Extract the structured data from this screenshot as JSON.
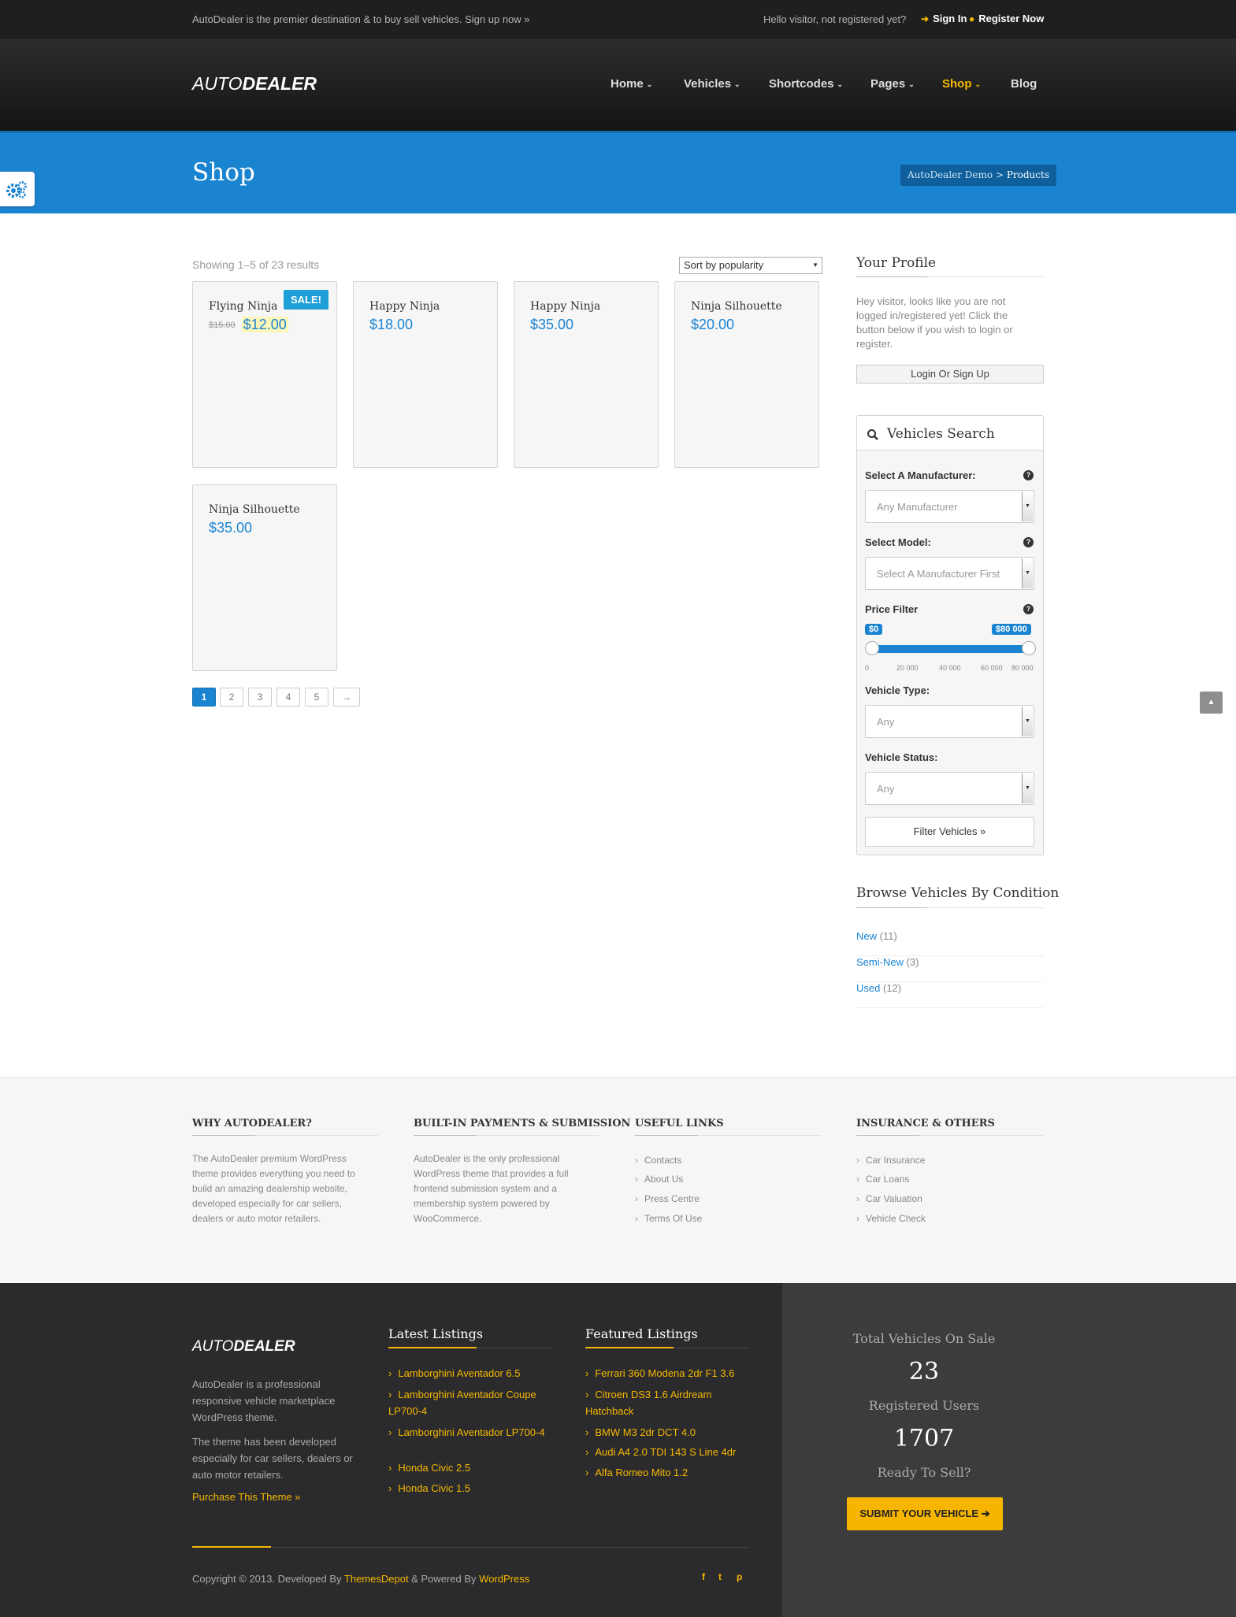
{
  "topbar": {
    "tagline": "AutoDealer is the premier destination & to buy sell vehicles. Sign up now »",
    "hello": "Hello visitor, not registered yet?",
    "sign_in": "Sign In",
    "register": "Register Now"
  },
  "header": {
    "logo_light": "AUTO",
    "logo_bold": "DEALER",
    "nav": [
      "Home",
      "Vehicles",
      "Shortcodes",
      "Pages",
      "Shop",
      "Blog"
    ],
    "active_nav": "Shop"
  },
  "band": {
    "title": "Shop",
    "breadcrumb_home": "AutoDealer Demo",
    "breadcrumb_sep": " > ",
    "breadcrumb_current": "Products"
  },
  "shop": {
    "results_text": "Showing 1–5 of 23 results",
    "sort_label": "Sort by popularity",
    "products": [
      {
        "name": "Flying Ninja",
        "old_price": "$15.00",
        "price": "$12.00",
        "sale": "SALE!"
      },
      {
        "name": "Happy Ninja",
        "price": "$18.00"
      },
      {
        "name": "Happy Ninja",
        "price": "$35.00"
      },
      {
        "name": "Ninja Silhouette",
        "price": "$20.00"
      },
      {
        "name": "Ninja Silhouette",
        "price": "$35.00"
      }
    ],
    "pages": [
      "1",
      "2",
      "3",
      "4",
      "5",
      "→"
    ]
  },
  "sidebar": {
    "profile_title": "Your Profile",
    "profile_text": "Hey visitor, looks like you are not logged in/registered yet! Click the button below if you wish to login or register.",
    "login_button": "Login Or Sign Up",
    "search_title": "Vehicles Search",
    "manufacturer_label": "Select A Manufacturer:",
    "manufacturer_value": "Any Manufacturer",
    "model_label": "Select Model:",
    "model_value": "Select A Manufacturer First",
    "price_label": "Price Filter",
    "price_min": "$0",
    "price_max": "$80 000",
    "price_ticks": [
      "0",
      "20 000",
      "40 000",
      "60 000",
      "80 000"
    ],
    "type_label": "Vehicle Type:",
    "type_value": "Any",
    "status_label": "Vehicle Status:",
    "status_value": "Any",
    "filter_button": "Filter Vehicles »",
    "condition_title": "Browse Vehicles By Condition",
    "conditions": [
      {
        "label": "New",
        "count": "(11)"
      },
      {
        "label": "Semi-New",
        "count": "(3)"
      },
      {
        "label": "Used",
        "count": "(12)"
      }
    ]
  },
  "footer_widgets": {
    "why_title": "WHY AUTODEALER?",
    "why_text": "The AutoDealer premium WordPress theme provides everything you need to build an amazing dealership website, developed especially for car sellers, dealers or auto motor retailers.",
    "payments_title": "BUILT-IN PAYMENTS & SUBMISSION",
    "payments_text": "AutoDealer is the only professional WordPress theme that provides a full frontend submission system and a membership system powered by WooCommerce.",
    "links_title": "USEFUL LINKS",
    "links": [
      "Contacts",
      "About Us",
      "Press Centre",
      "Terms Of Use"
    ],
    "insurance_title": "INSURANCE & OTHERS",
    "insurance": [
      "Car Insurance",
      "Car Loans",
      "Car Valuation",
      "Vehicle Check"
    ]
  },
  "footer": {
    "logo_light": "AUTO",
    "logo_bold": "DEALER",
    "about_1": "AutoDealer is a professional responsive vehicle marketplace WordPress theme.",
    "about_2": "The theme has been developed especially for car sellers, dealers or auto motor retailers.",
    "purchase": "Purchase This Theme »",
    "latest_title": "Latest Listings",
    "latest": [
      "Lamborghini Aventador 6.5",
      "Lamborghini Aventador Coupe LP700-4",
      "Lamborghini Aventador LP700-4",
      "Honda Civic 2.5",
      "Honda Civic 1.5"
    ],
    "featured_title": "Featured Listings",
    "featured": [
      "Ferrari 360 Modena 2dr F1 3.6",
      "Citroen DS3 1.6 Airdream Hatchback",
      "BMW M3 2dr DCT 4.0",
      "Audi A4 2.0 TDI 143 S Line 4dr",
      "Alfa Romeo Mito 1.2"
    ],
    "total_label": "Total Vehicles On Sale",
    "total_value": "23",
    "users_label": "Registered Users",
    "users_value": "1707",
    "ready_label": "Ready To Sell?",
    "submit_button": "SUBMIT YOUR VEHICLE",
    "copy_prefix": "Copyright © 2013. Developed By ",
    "copy_dev": "ThemesDepot",
    "copy_mid": " & Powered By ",
    "copy_wp": "WordPress",
    "social": [
      "f",
      "t",
      "p"
    ]
  },
  "colors": {
    "accent": "#1b84d1",
    "highlight": "#f5b800",
    "dark": "#2b2b2d"
  }
}
